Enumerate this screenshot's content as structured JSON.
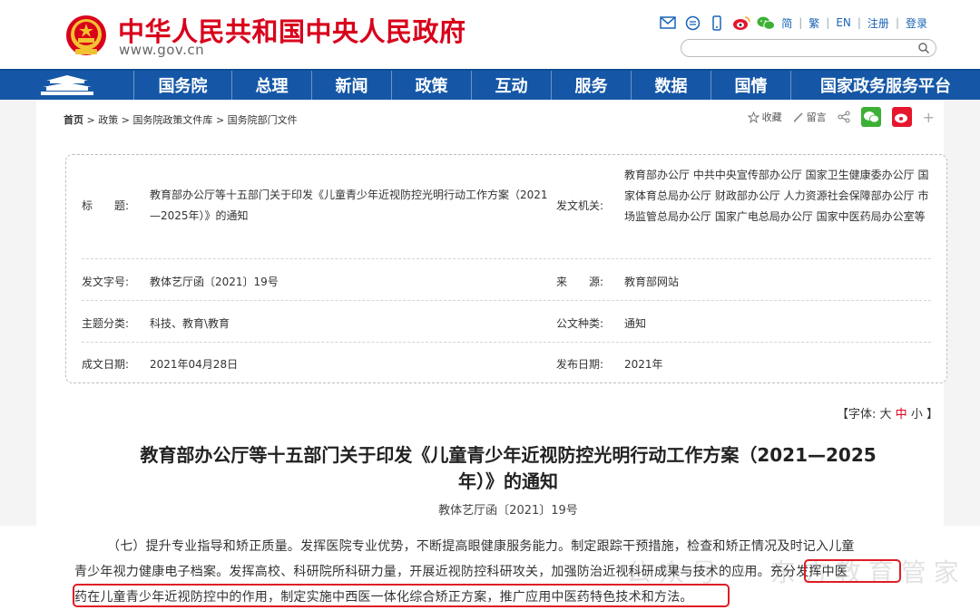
{
  "header": {
    "site_title": "中华人民共和国中央人民政府",
    "site_url": "www.gov.cn",
    "top_links": [
      "简",
      "繁",
      "EN",
      "注册",
      "登录"
    ],
    "search_placeholder": ""
  },
  "nav": {
    "items": [
      "国务院",
      "总理",
      "新闻",
      "政策",
      "互动",
      "服务",
      "数据",
      "国情",
      "国家政务服务平台"
    ]
  },
  "breadcrumb": [
    "首页",
    "政策",
    "国务院政策文件库",
    "国务院部门文件"
  ],
  "actions": {
    "favorite": "收藏",
    "comment": "留言"
  },
  "info": {
    "title_label": "标　　题:",
    "title_value": "教育部办公厅等十五部门关于印发《儿童青少年近视防控光明行动工作方案（2021—2025年）》的通知",
    "issuer_label": "发文机关:",
    "issuer_value": "教育部办公厅 中共中央宣传部办公厅 国家卫生健康委办公厅 国家体育总局办公厅 财政部办公厅 人力资源社会保障部办公厅 市场监管总局办公厅 国家广电总局办公厅 国家中医药局办公室等",
    "doc_no_label": "发文字号:",
    "doc_no_value": "教体艺厅函〔2021〕19号",
    "source_label": "来　　源:",
    "source_value": "教育部网站",
    "topic_label": "主题分类:",
    "topic_value": "科技、教育\\教育",
    "type_label": "公文种类:",
    "type_value": "通知",
    "date_label": "成文日期:",
    "date_value": "2021年04月28日",
    "pub_label": "发布日期:",
    "pub_value": "2021年"
  },
  "font_ctrl": {
    "prefix": "【字体:",
    "large": "大",
    "medium": "中",
    "small": "小",
    "suffix": "】"
  },
  "doc": {
    "title_line1": "教育部办公厅等十五部门关于印发《儿童青少年近视防控光明行动工作方案（2021—2025",
    "title_line2": "年）》的通知",
    "number": "教体艺厅函〔2021〕19号"
  },
  "article": {
    "line1": "（七）提升专业指导和矫正质量。发挥医院专业优势，不断提高眼健康服务能力。制定跟踪干预措施，检查和矫正情况及时记入儿童",
    "line2": "青少年视力健康电子档案。发挥高校、科研院所科研力量，开展近视防控科研攻关，加强防治近视科研成果与技术的应用。充分发挥中医",
    "line3": "药在儿童青少年近视防控中的作用，制定实施中西医一体化综合矫正方案，推广应用中医药特色技术和方法。",
    "watermark": "公众号 · 东方教育管家"
  },
  "colors": {
    "brand_red": "#d9001b",
    "nav_blue": "#1557a6",
    "link_blue": "#1a64b7",
    "highlight_red": "#e01c24",
    "wechat_green": "#3cb034",
    "weibo_red": "#e6162d"
  }
}
